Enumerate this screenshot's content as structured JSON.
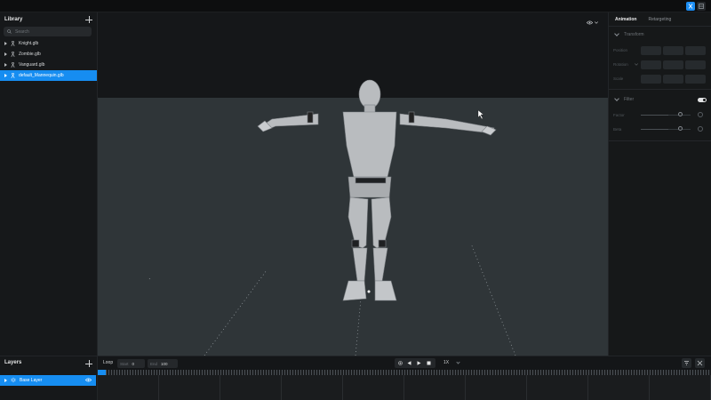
{
  "library": {
    "title": "Library",
    "add_icon": "plus-icon",
    "search_placeholder": "Search",
    "items": [
      {
        "label": "Knight.glb",
        "selected": false
      },
      {
        "label": "Zombie.glb",
        "selected": false
      },
      {
        "label": "Vanguard.glb",
        "selected": false
      },
      {
        "label": "default_Mannequin.glb",
        "selected": true
      }
    ]
  },
  "layers": {
    "title": "Layers",
    "base_layer": "Base Layer"
  },
  "inspector": {
    "tabs": [
      {
        "label": "Animation",
        "active": true
      },
      {
        "label": "Retargeting",
        "active": false
      }
    ],
    "transform": {
      "title": "Transform",
      "rows": [
        "Position",
        "Rotation",
        "Scale"
      ]
    },
    "filter": {
      "title": "Filter",
      "enabled": true,
      "rows": [
        "Factor",
        "Beta"
      ]
    }
  },
  "timeline": {
    "loop_label": "Loop",
    "start_label": "Start",
    "start_value": "0",
    "end_label": "End",
    "end_value": "100",
    "speed": "1X"
  },
  "colors": {
    "accent": "#168df1",
    "floor": "#2f3538",
    "background": "#111213"
  }
}
